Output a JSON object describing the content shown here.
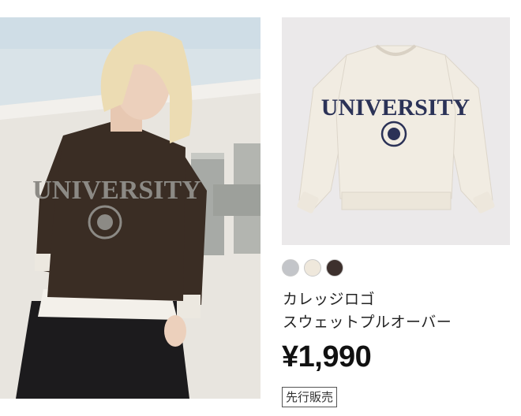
{
  "product": {
    "title_line1": "カレッジロゴ",
    "title_line2": "スウェットプルオーバー",
    "price": "¥1,990",
    "badge": "先行販売",
    "print_text": "UNIVERSITY"
  },
  "swatches": [
    {
      "name": "gray",
      "color": "#c3c5c9"
    },
    {
      "name": "off-white",
      "color": "#efe8dc"
    },
    {
      "name": "dark-brown",
      "color": "#3d302d"
    }
  ],
  "colors": {
    "sweatshirt_brown": "#3a2d24",
    "sweatshirt_offwhite": "#f1ece2",
    "navy_print": "#2b3257",
    "gray_print": "#8c8a85"
  }
}
